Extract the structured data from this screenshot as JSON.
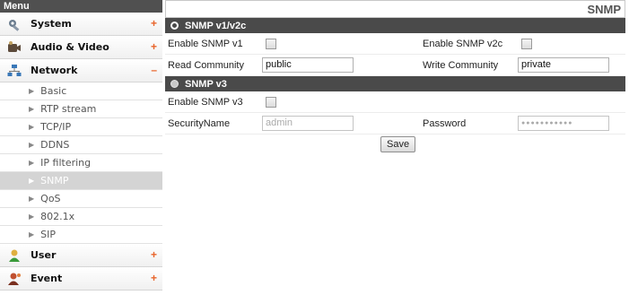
{
  "sidebar": {
    "menu_title": "Menu",
    "system": {
      "label": "System",
      "toggle": "+"
    },
    "audio_video": {
      "label": "Audio & Video",
      "toggle": "+"
    },
    "network": {
      "label": "Network",
      "toggle": "–",
      "items": [
        {
          "label": "Basic"
        },
        {
          "label": "RTP stream"
        },
        {
          "label": "TCP/IP"
        },
        {
          "label": "DDNS"
        },
        {
          "label": "IP filtering"
        },
        {
          "label": "SNMP"
        },
        {
          "label": "QoS"
        },
        {
          "label": "802.1x"
        },
        {
          "label": "SIP"
        }
      ]
    },
    "user": {
      "label": "User",
      "toggle": "+"
    },
    "event": {
      "label": "Event",
      "toggle": "+"
    },
    "arrow_glyph": "▶"
  },
  "main": {
    "page_title": "SNMP",
    "v1v2c": {
      "header": "SNMP v1/v2c",
      "enable_v1_label": "Enable SNMP v1",
      "enable_v2c_label": "Enable  SNMP v2c",
      "read_community_label": "Read Community",
      "read_community_value": "public",
      "write_community_label": "Write Community",
      "write_community_value": "private"
    },
    "v3": {
      "header": "SNMP v3",
      "enable_v3_label": "Enable  SNMP v3",
      "security_name_label": "SecurityName",
      "security_name_value": "admin",
      "password_label": "Password",
      "password_value": "●●●●●●●●●●●"
    },
    "save_label": "Save"
  },
  "colors": {
    "section_bg": "#4a4a4a",
    "active_item_bg": "#d4d4d4",
    "toggle_accent": "#e8642a"
  }
}
